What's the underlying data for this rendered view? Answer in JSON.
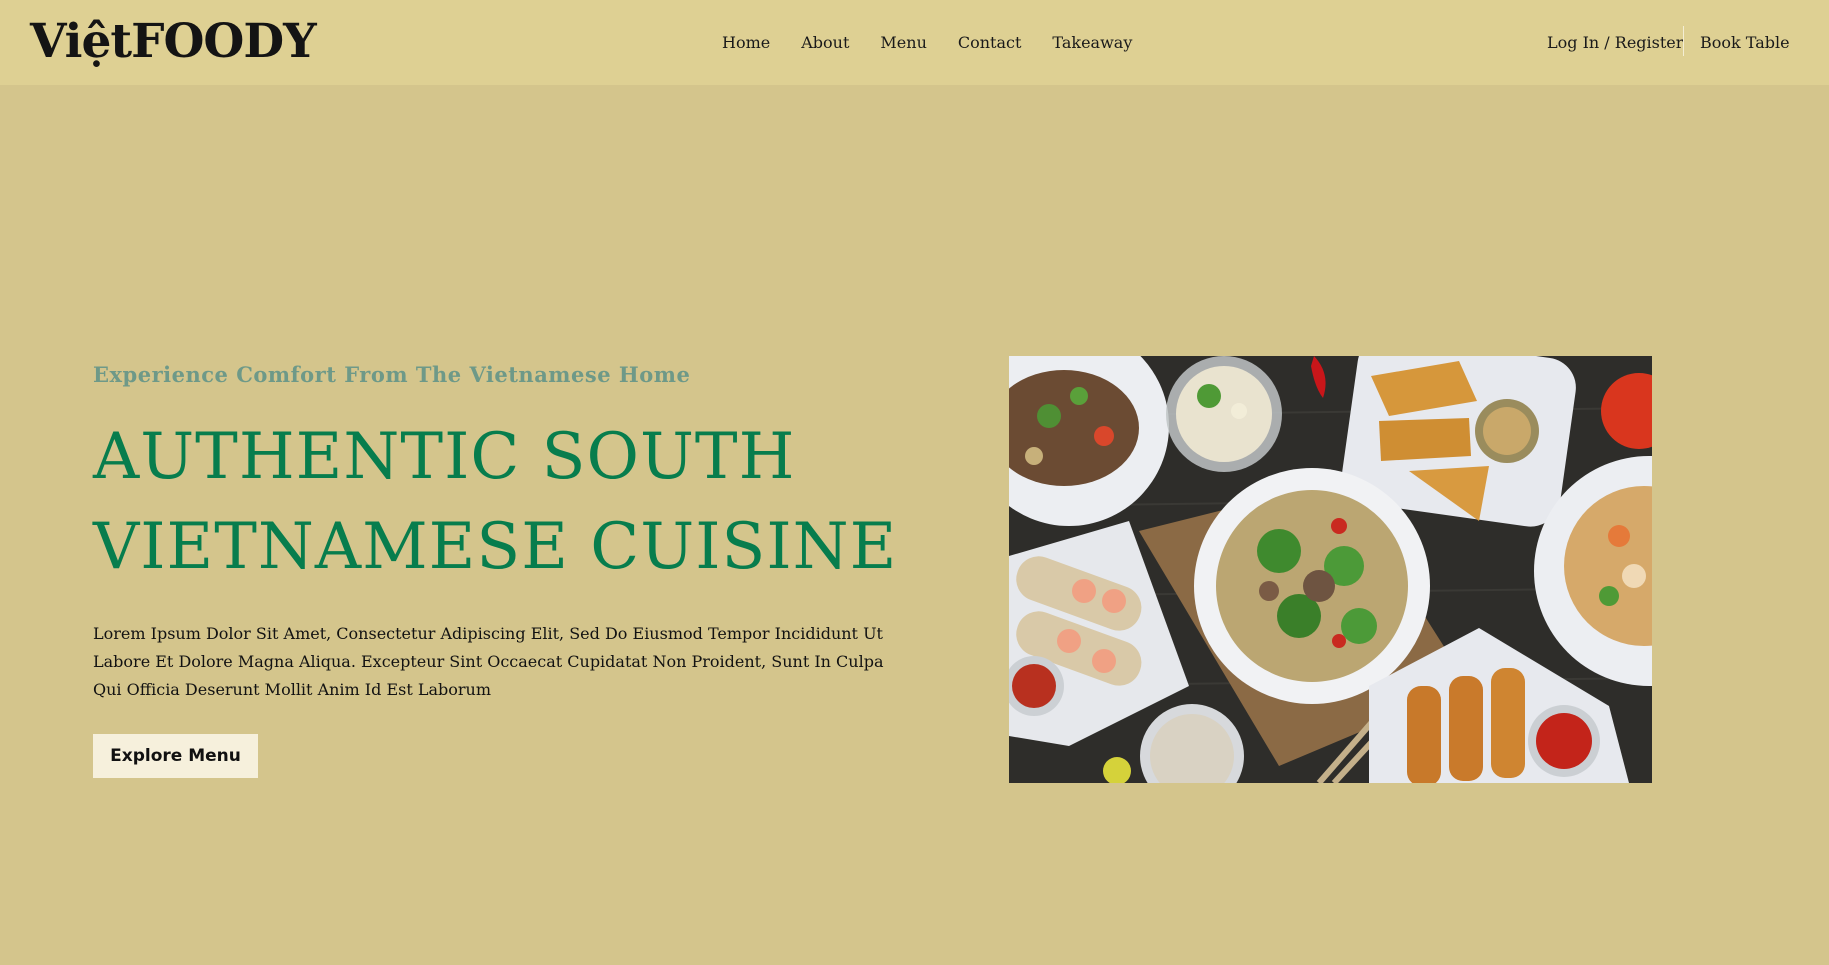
{
  "brand": {
    "logo_text": "ViệtFOODY"
  },
  "nav": {
    "items": [
      {
        "label": "Home"
      },
      {
        "label": "About"
      },
      {
        "label": "Menu"
      },
      {
        "label": "Contact"
      },
      {
        "label": "Takeaway"
      }
    ]
  },
  "account": {
    "login_label": "Log In / Register",
    "book_label": "Book Table"
  },
  "hero": {
    "tagline": "Experience Comfort From The Vietnamese Home",
    "headline_line1": "AUTHENTIC SOUTH",
    "headline_line2": "VIETNAMESE CUISINE",
    "description": "Lorem Ipsum Dolor Sit Amet, Consectetur Adipiscing Elit, Sed Do Eiusmod Tempor Incididunt Ut Labore Et Dolore Magna Aliqua. Excepteur Sint Occaecat Cupidatat Non Proident, Sunt In Culpa Qui Officia Deserunt Mollit Anim Id Est Laborum",
    "cta_label": "Explore Menu"
  },
  "colors": {
    "page_bg": "#d4c58c",
    "header_bg": "#ded093",
    "headline": "#077d4d",
    "tagline": "#6e9988",
    "button_bg": "#f6f0dc"
  },
  "image": {
    "subject": "vietnamese-food-spread-photo"
  }
}
